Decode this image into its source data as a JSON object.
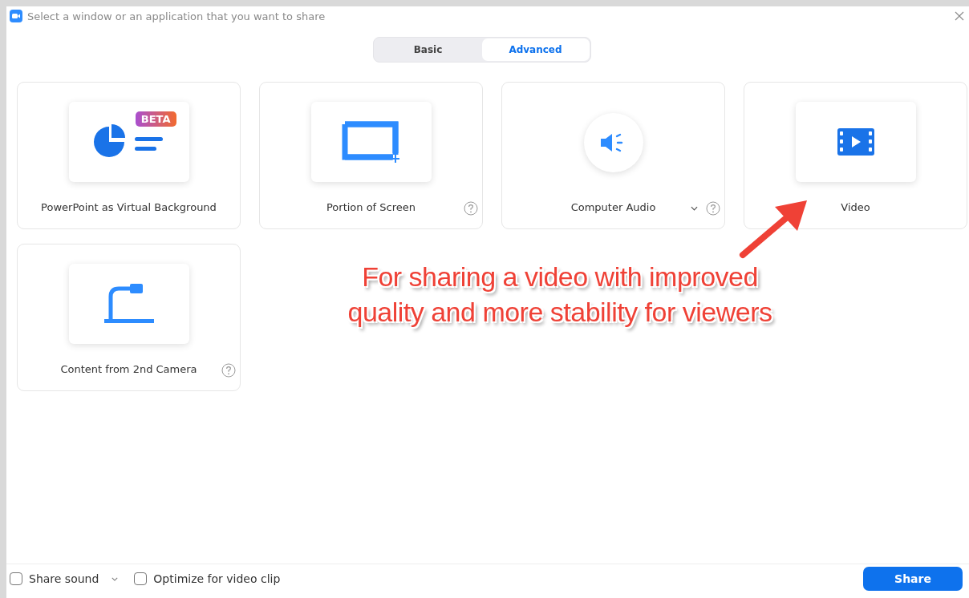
{
  "window": {
    "title": "Select a window or an application that you want to share"
  },
  "tabs": [
    {
      "label": "Basic",
      "selected": false
    },
    {
      "label": "Advanced",
      "selected": true
    }
  ],
  "cards": [
    {
      "kind": "slides",
      "label": "PowerPoint as Virtual Background",
      "badge": "BETA",
      "help": false,
      "dropdown": false
    },
    {
      "kind": "portion",
      "label": "Portion of Screen",
      "help": true,
      "dropdown": false
    },
    {
      "kind": "audio",
      "label": "Computer Audio",
      "help": true,
      "dropdown": true
    },
    {
      "kind": "video",
      "label": "Video",
      "help": false,
      "dropdown": false
    },
    {
      "kind": "camera",
      "label": "Content from 2nd Camera",
      "help": true,
      "dropdown": false
    }
  ],
  "annotation": {
    "lines": [
      "For sharing a video with improved",
      "quality and more stability for viewers"
    ]
  },
  "footer": {
    "options": [
      {
        "label": "Share sound",
        "checked": false,
        "dropdown": true
      },
      {
        "label": "Optimize for video clip",
        "checked": false,
        "dropdown": false
      }
    ],
    "share_button": "Share"
  }
}
